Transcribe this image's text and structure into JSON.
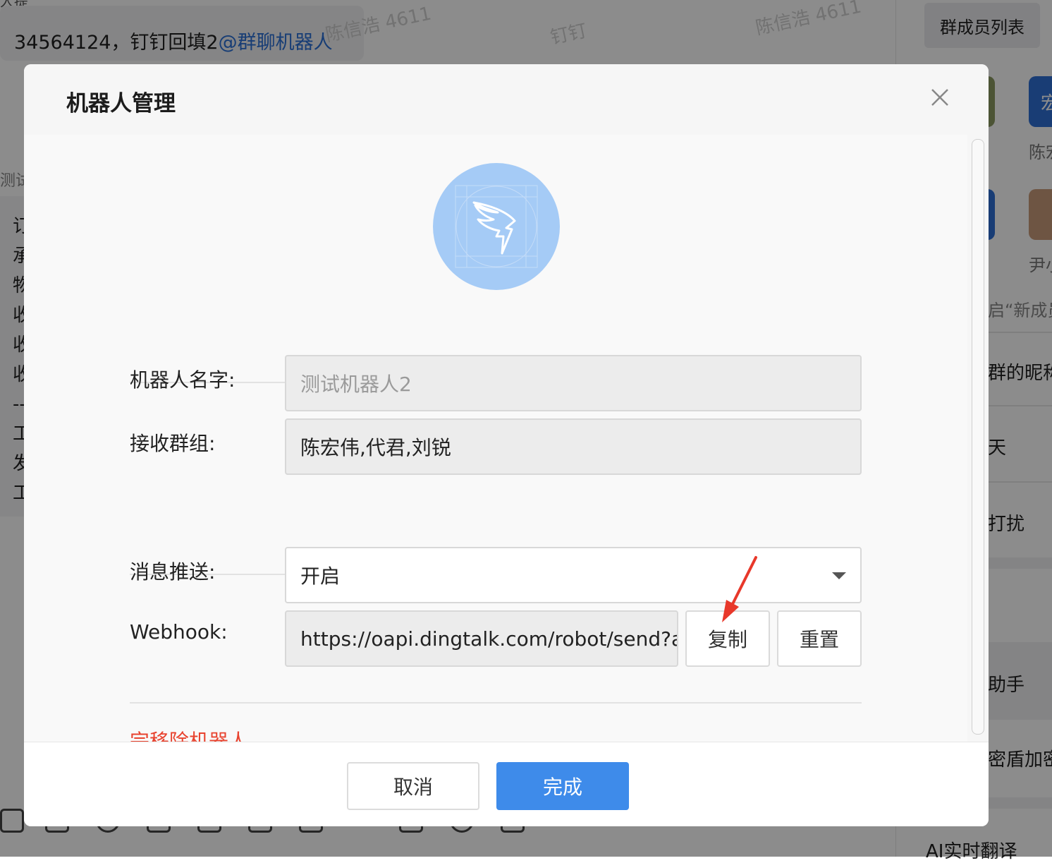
{
  "background": {
    "top_left_text": "人提",
    "message": {
      "text": "34564124，钉钉回填2",
      "mention": "@群聊机器人"
    },
    "test_label": "测试",
    "card_lines": [
      "订",
      "承",
      "物",
      "收",
      "收",
      "收",
      "--",
      "工",
      "发",
      "工"
    ],
    "watermarks": [
      "陈信浩 4611",
      "钉钉",
      "陈信浩 4611"
    ],
    "member_list_button": "群成员列表",
    "members": [
      {
        "name": "陈宏",
        "avatar_text": "宏"
      },
      {
        "name": "尹小"
      }
    ],
    "panel_items": [
      "启“新成员",
      "群的昵称",
      "天",
      "打扰",
      "助手",
      "密盾加密",
      "AI实时翻译"
    ]
  },
  "modal": {
    "title": "机器人管理",
    "form": {
      "name_label": "机器人名字:",
      "name_placeholder": "测试机器人2",
      "group_label": "接收群组:",
      "group_value": "陈宏伟,代君,刘锐",
      "push_label": "消息推送:",
      "push_value": "开启",
      "webhook_label": "Webhook:",
      "webhook_value": "https://oapi.dingtalk.com/robot/send?a",
      "copy_button": "复制",
      "reset_button": "重置",
      "remove_link": "完移除机器人"
    },
    "footer": {
      "cancel": "取消",
      "done": "完成"
    }
  },
  "colors": {
    "primary": "#3e8bea",
    "danger": "#e8432f",
    "avatar_bg": "#a5cbf6",
    "annotation": "#e8382a"
  },
  "icons": {
    "close": "close-icon",
    "dropdown": "chevron-down-icon",
    "robot": "dingtalk-logo-icon",
    "annotation": "red-arrow-annotation"
  }
}
